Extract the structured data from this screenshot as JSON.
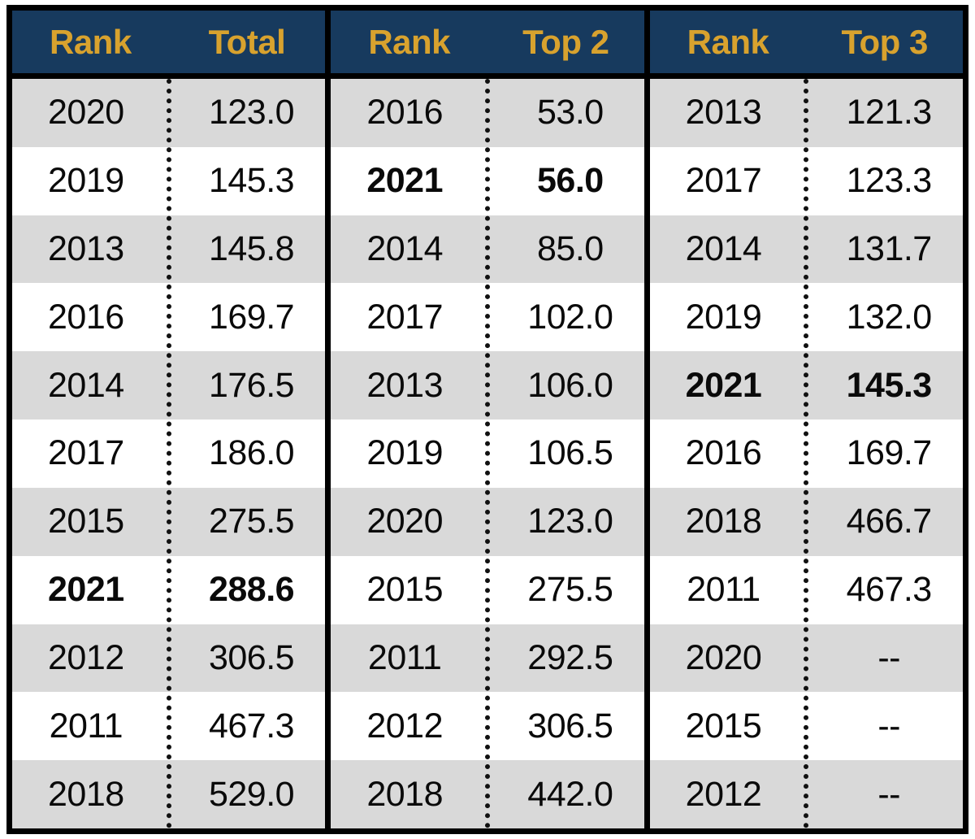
{
  "table": {
    "blocks": [
      {
        "id": "total",
        "headers": {
          "rank": "Rank",
          "value": "Total"
        },
        "rows": [
          {
            "rank": "2020",
            "value": "123.0",
            "bold": false
          },
          {
            "rank": "2019",
            "value": "145.3",
            "bold": false
          },
          {
            "rank": "2013",
            "value": "145.8",
            "bold": false
          },
          {
            "rank": "2016",
            "value": "169.7",
            "bold": false
          },
          {
            "rank": "2014",
            "value": "176.5",
            "bold": false
          },
          {
            "rank": "2017",
            "value": "186.0",
            "bold": false
          },
          {
            "rank": "2015",
            "value": "275.5",
            "bold": false
          },
          {
            "rank": "2021",
            "value": "288.6",
            "bold": true
          },
          {
            "rank": "2012",
            "value": "306.5",
            "bold": false
          },
          {
            "rank": "2011",
            "value": "467.3",
            "bold": false
          },
          {
            "rank": "2018",
            "value": "529.0",
            "bold": false
          }
        ]
      },
      {
        "id": "top2",
        "headers": {
          "rank": "Rank",
          "value": "Top 2"
        },
        "rows": [
          {
            "rank": "2016",
            "value": "53.0",
            "bold": false
          },
          {
            "rank": "2021",
            "value": "56.0",
            "bold": true
          },
          {
            "rank": "2014",
            "value": "85.0",
            "bold": false
          },
          {
            "rank": "2017",
            "value": "102.0",
            "bold": false
          },
          {
            "rank": "2013",
            "value": "106.0",
            "bold": false
          },
          {
            "rank": "2019",
            "value": "106.5",
            "bold": false
          },
          {
            "rank": "2020",
            "value": "123.0",
            "bold": false
          },
          {
            "rank": "2015",
            "value": "275.5",
            "bold": false
          },
          {
            "rank": "2011",
            "value": "292.5",
            "bold": false
          },
          {
            "rank": "2012",
            "value": "306.5",
            "bold": false
          },
          {
            "rank": "2018",
            "value": "442.0",
            "bold": false
          }
        ]
      },
      {
        "id": "top3",
        "headers": {
          "rank": "Rank",
          "value": "Top 3"
        },
        "rows": [
          {
            "rank": "2013",
            "value": "121.3",
            "bold": false
          },
          {
            "rank": "2017",
            "value": "123.3",
            "bold": false
          },
          {
            "rank": "2014",
            "value": "131.7",
            "bold": false
          },
          {
            "rank": "2019",
            "value": "132.0",
            "bold": false
          },
          {
            "rank": "2021",
            "value": "145.3",
            "bold": true
          },
          {
            "rank": "2016",
            "value": "169.7",
            "bold": false
          },
          {
            "rank": "2018",
            "value": "466.7",
            "bold": false
          },
          {
            "rank": "2011",
            "value": "467.3",
            "bold": false
          },
          {
            "rank": "2020",
            "value": "--",
            "bold": false
          },
          {
            "rank": "2015",
            "value": "--",
            "bold": false
          },
          {
            "rank": "2012",
            "value": "--",
            "bold": false
          }
        ]
      }
    ]
  },
  "colors": {
    "header_background": "#173A5E",
    "header_text": "#D8A22E",
    "row_shaded": "#D9D9D9",
    "row_plain": "#FFFFFF",
    "border": "#000000",
    "cell_text": "#0A0A0A"
  },
  "chart_data": {
    "type": "table",
    "title": "",
    "columns": [
      "Rank",
      "Total",
      "Rank",
      "Top 2",
      "Rank",
      "Top 3"
    ],
    "highlighted_row_key": "2021",
    "series": [
      {
        "name": "Total",
        "categories": [
          "2020",
          "2019",
          "2013",
          "2016",
          "2014",
          "2017",
          "2015",
          "2021",
          "2012",
          "2011",
          "2018"
        ],
        "values": [
          123.0,
          145.3,
          145.8,
          169.7,
          176.5,
          186.0,
          275.5,
          288.6,
          306.5,
          467.3,
          529.0
        ]
      },
      {
        "name": "Top 2",
        "categories": [
          "2016",
          "2021",
          "2014",
          "2017",
          "2013",
          "2019",
          "2020",
          "2015",
          "2011",
          "2012",
          "2018"
        ],
        "values": [
          53.0,
          56.0,
          85.0,
          102.0,
          106.0,
          106.5,
          123.0,
          275.5,
          292.5,
          306.5,
          442.0
        ]
      },
      {
        "name": "Top 3",
        "categories": [
          "2013",
          "2017",
          "2014",
          "2019",
          "2021",
          "2016",
          "2018",
          "2011",
          "2020",
          "2015",
          "2012"
        ],
        "values": [
          121.3,
          123.3,
          131.7,
          132.0,
          145.3,
          169.7,
          466.7,
          467.3,
          null,
          null,
          null
        ]
      }
    ]
  }
}
